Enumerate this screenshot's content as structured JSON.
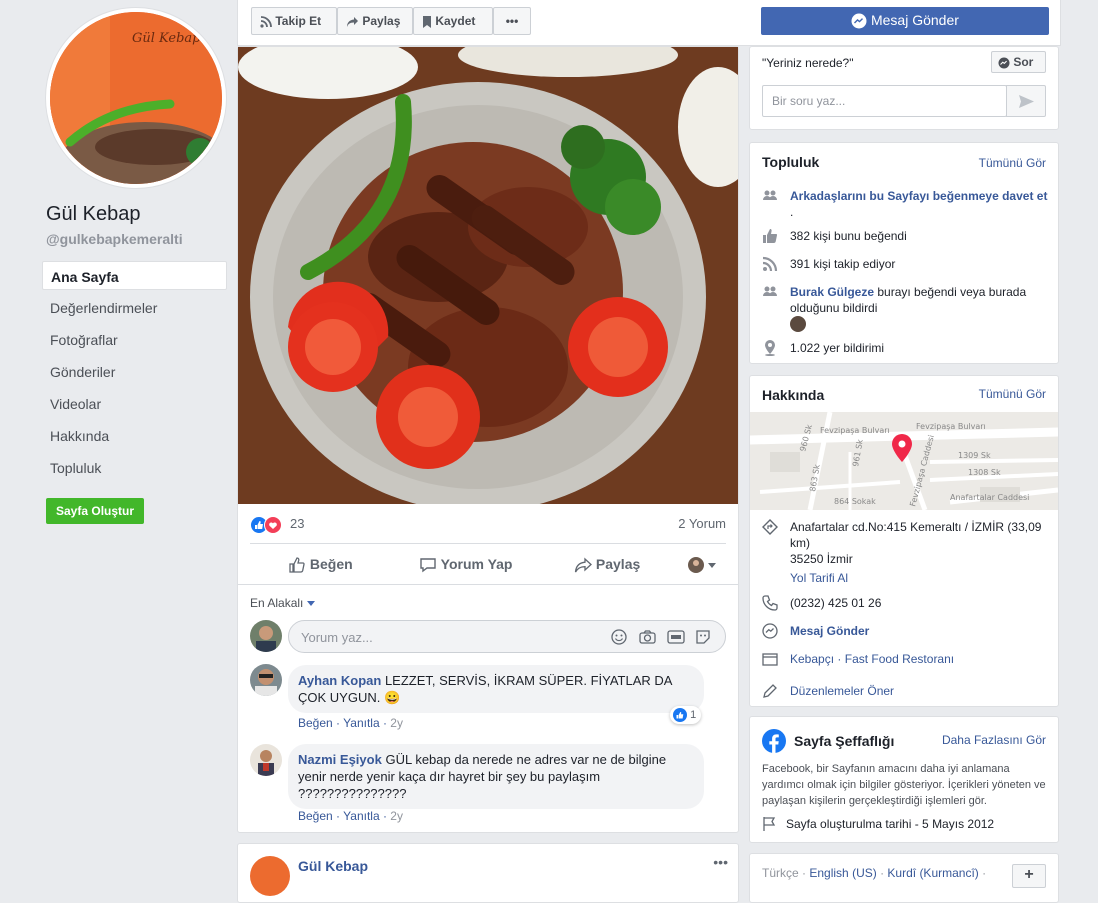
{
  "page": {
    "name": "Gül Kebap",
    "handle": "@gulkebapkemeralti"
  },
  "nav": {
    "items": [
      {
        "label": "Ana Sayfa"
      },
      {
        "label": "Değerlendirmeler"
      },
      {
        "label": "Fotoğraflar"
      },
      {
        "label": "Gönderiler"
      },
      {
        "label": "Videolar"
      },
      {
        "label": "Hakkında"
      },
      {
        "label": "Topluluk"
      }
    ],
    "create_page": "Sayfa Oluştur"
  },
  "toolbar": {
    "follow": "Takip Et",
    "share": "Paylaş",
    "save": "Kaydet",
    "more": "•••",
    "message": "Mesaj Gönder"
  },
  "post": {
    "reaction_count": "23",
    "comment_count": "2 Yorum",
    "actions": {
      "like": "Beğen",
      "comment": "Yorum Yap",
      "share": "Paylaş"
    },
    "sort": "En Alakalı",
    "comment_placeholder": "Yorum yaz...",
    "comments": [
      {
        "author": "Ayhan Kopan",
        "text": "LEZZET, SERVİS, İKRAM SÜPER. FİYATLAR DA ÇOK UYGUN. 😀",
        "like": "Beğen",
        "reply": "Yanıtla",
        "time": "2y",
        "reactions": "1"
      },
      {
        "author": "Nazmi Eşiyok",
        "text": "GÜL kebap da nerede ne adres var ne de bilgine yenir nerde yenir kaça dır hayret bir şey bu paylaşım ???????????????",
        "like": "Beğen",
        "reply": "Yanıtla",
        "time": "2y"
      }
    ]
  },
  "next_post": {
    "author": "Gül Kebap",
    "more": "•••"
  },
  "ask": {
    "question": "\"Yeriniz nerede?\"",
    "ask_button": "Sor",
    "placeholder": "Bir soru yaz..."
  },
  "community": {
    "title": "Topluluk",
    "see_all": "Tümünü Gör",
    "invite": "Arkadaşlarını bu Sayfayı beğenmeye davet et",
    "invite_suffix": ".",
    "likes": "382 kişi bunu beğendi",
    "follows": "391 kişi takip ediyor",
    "friend_name": "Burak Gülgeze",
    "friend_text": "burayı beğendi veya burada olduğunu bildirdi",
    "checkins": "1.022 yer bildirimi"
  },
  "about": {
    "title": "Hakkında",
    "see_all": "Tümünü Gör",
    "address": "Anafartalar cd.No:415 Kemeraltı / İZMİR (33,09 km)",
    "postal": "35250 İzmir",
    "directions": "Yol Tarifi Al",
    "phone": "(0232) 425 01 26",
    "message": "Mesaj Gönder",
    "category1": "Kebapçı",
    "category_sep": "·",
    "category2": "Fast Food Restoranı",
    "suggest": "Düzenlemeler Öner",
    "map_labels": {
      "s1": "Fevzipaşa Bulvarı",
      "s2": "Fevzipaşa Bulvarı",
      "s3": "1309 Sk",
      "s4": "1308 Sk",
      "s5": "Anafartalar Caddesi",
      "s6": "960 Sk",
      "s7": "961 Sk",
      "s8": "863 Sk",
      "s9": "864 Sokak",
      "s10": "Fevzipaşa Caddesi"
    }
  },
  "transparency": {
    "title": "Sayfa Şeffaflığı",
    "more": "Daha Fazlasını Gör",
    "desc": "Facebook, bir Sayfanın amacını daha iyi anlamana yardımcı olmak için bilgiler gösteriyor. İçerikleri yöneten ve paylaşan kişilerin gerçekleştirdiği işlemleri gör.",
    "created": "Sayfa oluşturulma tarihi - 5 Mayıs 2012"
  },
  "languages": {
    "l1": "Türkçe",
    "l2": "English (US)",
    "l3": "Kurdî (Kurmancî)",
    "sep": "·",
    "add": "+"
  },
  "colors": {
    "fb_blue": "#4267b2",
    "link": "#385898",
    "green": "#42b72a",
    "bg": "#e9ebee"
  }
}
